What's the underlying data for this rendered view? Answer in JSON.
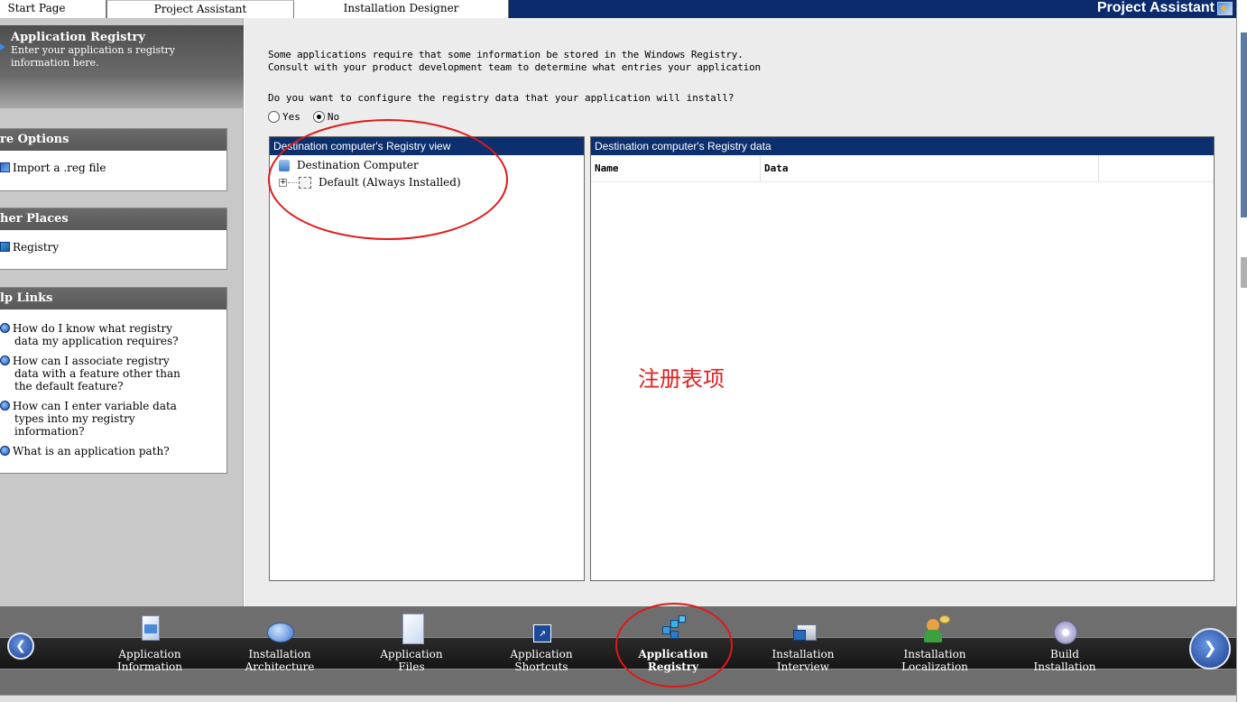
{
  "tabs": [
    {
      "label": "Start Page"
    },
    {
      "label": "Project Assistant"
    },
    {
      "label": "Installation Designer"
    }
  ],
  "brand": {
    "title": "Project Assistant"
  },
  "left_panel": {
    "header": {
      "title": "Application Registry",
      "description_line1": "Enter your application s registry",
      "description_line2": "information here."
    },
    "more_options": {
      "title": "re Options",
      "items": [
        {
          "label": "Import a .reg file",
          "icon": "import-reg-icon"
        }
      ]
    },
    "other_places": {
      "title": "her Places",
      "items": [
        {
          "label": "Registry",
          "icon": "registry-icon"
        }
      ]
    },
    "help_links": {
      "title": "lp Links",
      "items": [
        {
          "line1": "How do I know what registry",
          "line2": "data my application requires?",
          "line3": ""
        },
        {
          "line1": "How can I associate registry",
          "line2": "data with a feature other than",
          "line3": "the default feature?"
        },
        {
          "line1": "How can I enter variable data",
          "line2": "types into my registry",
          "line3": "information?"
        },
        {
          "line1": "What is an application path?",
          "line2": "",
          "line3": ""
        }
      ]
    }
  },
  "main": {
    "intro_line1": "Some applications require that some information be stored in the Windows Registry.",
    "intro_line2": "Consult with your product development team to determine what entries your application",
    "question": "Do you want to configure the registry data that your application will install?",
    "options": [
      {
        "label": "Yes",
        "selected": false
      },
      {
        "label": "No",
        "selected": true
      }
    ],
    "registry_view": {
      "title": "Destination computer's Registry view",
      "root": "Destination Computer",
      "child": "Default (Always Installed)"
    },
    "registry_data": {
      "title": "Destination computer's Registry data",
      "columns": [
        "Name",
        "Data",
        ""
      ]
    },
    "annotation": "注册表项",
    "annotation_color": "#e02020"
  },
  "navbar": {
    "items": [
      {
        "line1": "Application",
        "line2": "Information",
        "icon": "application-information-icon",
        "active": false
      },
      {
        "line1": "Installation",
        "line2": "Architecture",
        "icon": "installation-architecture-icon",
        "active": false
      },
      {
        "line1": "Application",
        "line2": "Files",
        "icon": "application-files-icon",
        "active": false
      },
      {
        "line1": "Application",
        "line2": "Shortcuts",
        "icon": "application-shortcuts-icon",
        "active": false
      },
      {
        "line1": "Application",
        "line2": "Registry",
        "icon": "application-registry-icon",
        "active": true
      },
      {
        "line1": "Installation",
        "line2": "Interview",
        "icon": "installation-interview-icon",
        "active": false
      },
      {
        "line1": "Installation",
        "line2": "Localization",
        "icon": "installation-localization-icon",
        "active": false
      },
      {
        "line1": "Build",
        "line2": "Installation",
        "icon": "build-installation-icon",
        "active": false
      }
    ]
  },
  "colors": {
    "title_bar": "#0a2a6b",
    "pane_header": "#0c2f6e",
    "annotation_red": "#e01818"
  }
}
